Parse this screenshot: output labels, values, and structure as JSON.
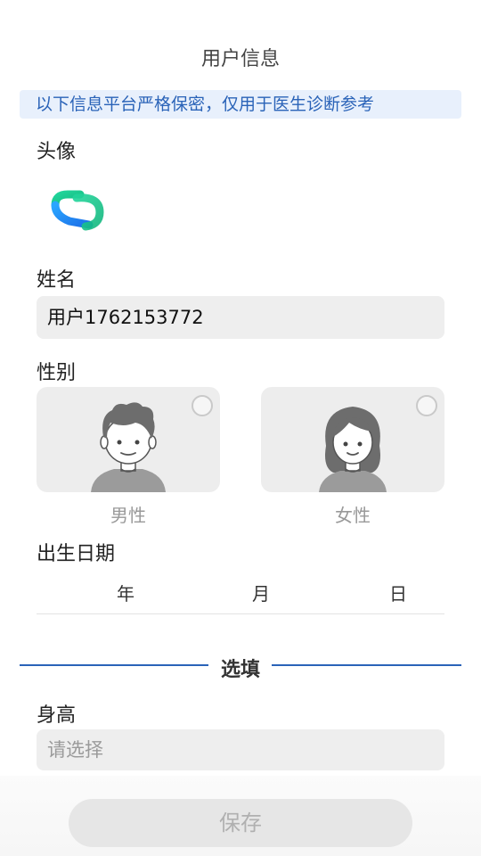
{
  "header": {
    "title": "用户信息"
  },
  "notice": "以下信息平台严格保密，仅用于医生诊断参考",
  "avatar": {
    "label": "头像",
    "icon": "app-logo-icon"
  },
  "name": {
    "label": "姓名",
    "value": "用户1762153772"
  },
  "gender": {
    "label": "性别",
    "options": [
      {
        "label": "男性",
        "icon": "male-avatar-icon",
        "selected": false
      },
      {
        "label": "女性",
        "icon": "female-avatar-icon",
        "selected": false
      }
    ]
  },
  "birthdate": {
    "label": "出生日期",
    "year_unit": "年",
    "month_unit": "月",
    "day_unit": "日"
  },
  "optional": {
    "label": "选填"
  },
  "height": {
    "label": "身高",
    "placeholder": "请选择"
  },
  "footer": {
    "save_label": "保存"
  },
  "colors": {
    "accent": "#2a63b8",
    "notice_bg": "#e8f0fc",
    "field_bg": "#eeeeee"
  }
}
